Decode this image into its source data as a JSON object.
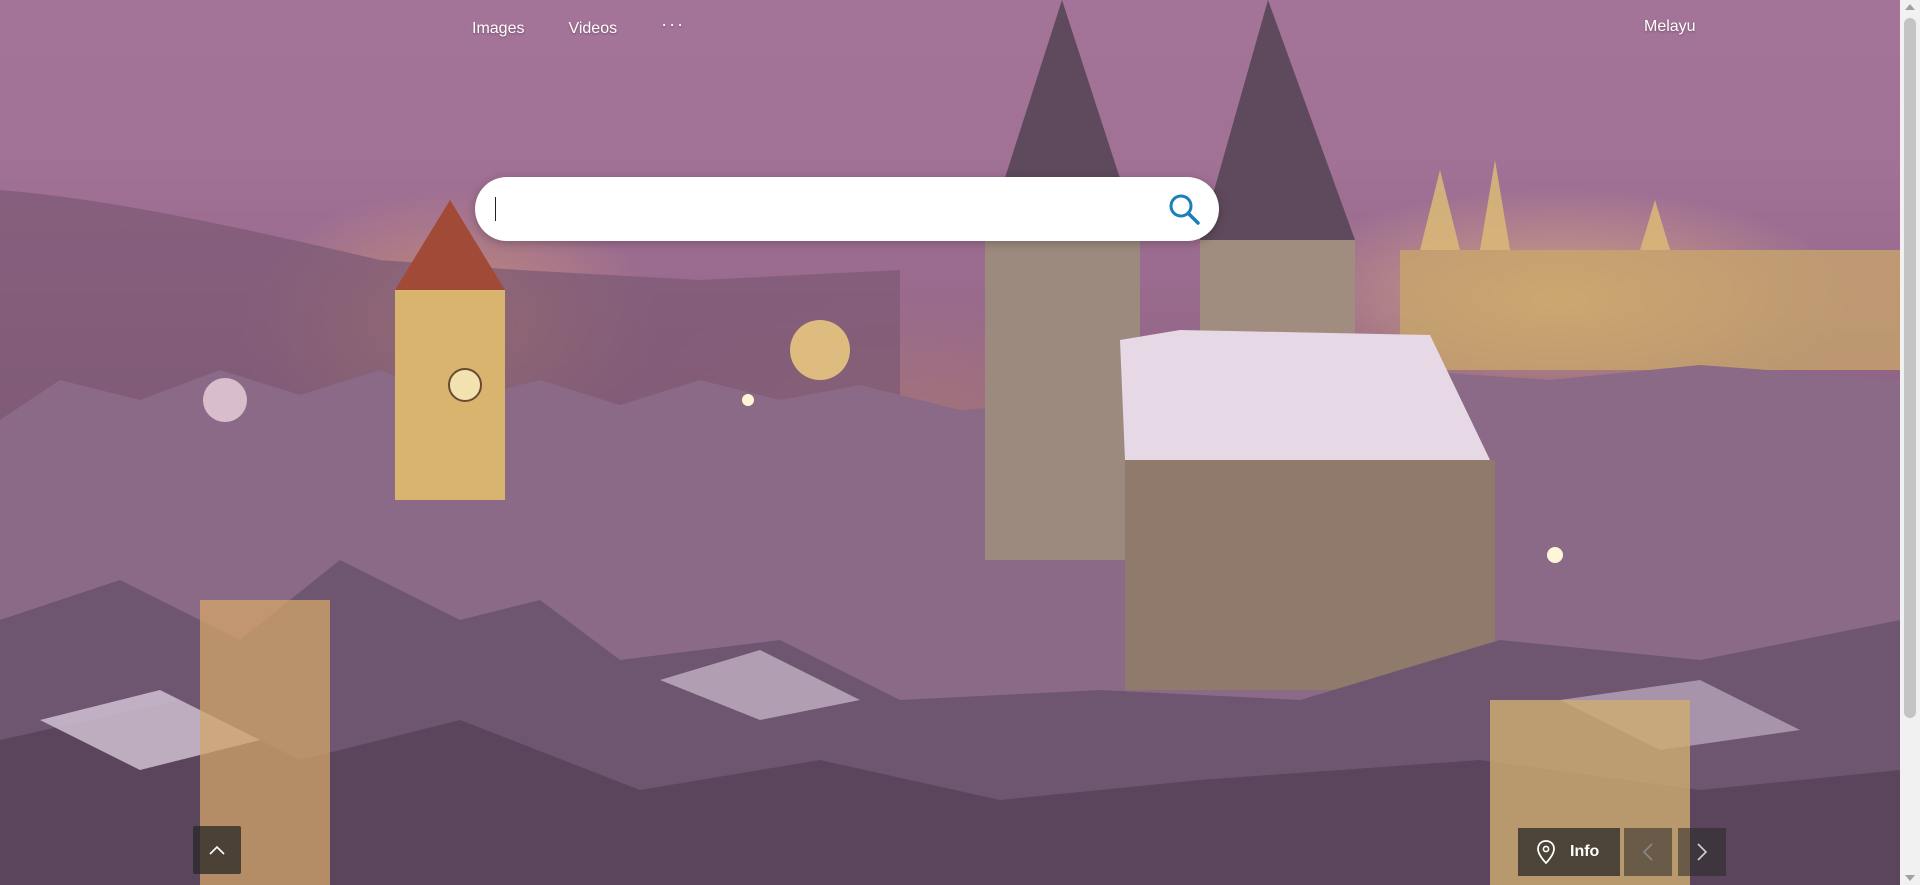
{
  "nav": {
    "links": [
      {
        "label": "Images"
      },
      {
        "label": "Videos"
      }
    ],
    "more_label": "···",
    "language_label": "Melayu"
  },
  "search": {
    "value": "",
    "placeholder": "",
    "icon": "search-icon"
  },
  "footer": {
    "info_label": "Info",
    "icons": [
      "chevron-up-icon",
      "location-pin-icon",
      "chevron-left-icon",
      "chevron-right-icon"
    ]
  },
  "colors": {
    "search_icon": "#1a7fb8",
    "control_bg": "#282828"
  }
}
